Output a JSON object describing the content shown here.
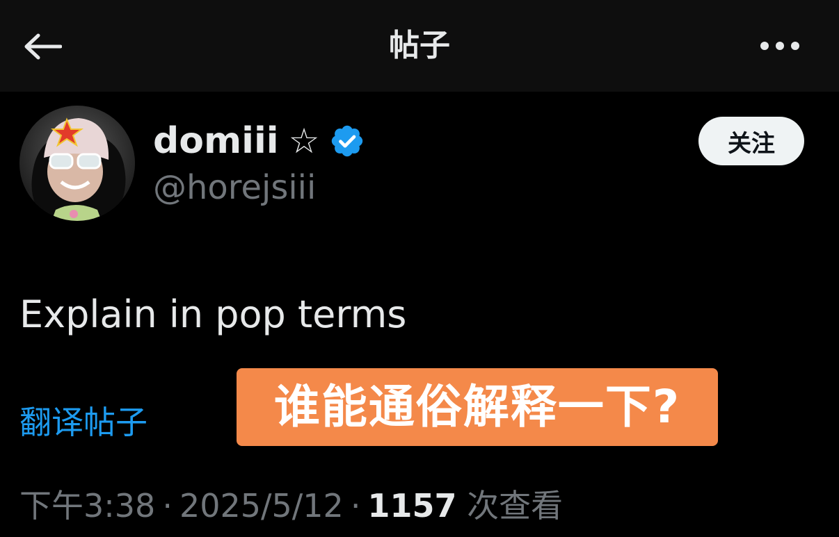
{
  "header": {
    "title": "帖子",
    "back_icon": "arrow-left-icon",
    "more_icon": "more-horizontal-icon"
  },
  "author": {
    "display_name": "domiii",
    "name_emoji": "☆",
    "handle": "@horejsiii",
    "verified": true,
    "verified_color": "#1d9bf0",
    "follow_label": "关注"
  },
  "post": {
    "text": "Explain in pop terms",
    "translate_label": "翻译帖子",
    "caption_overlay": "谁能通俗解释一下?"
  },
  "meta": {
    "time": "下午3:38",
    "date": "2025/5/12",
    "separator": "·",
    "views_count": "1157",
    "views_label": "次查看"
  },
  "colors": {
    "background": "#000000",
    "accent": "#1d9bf0",
    "caption_bg": "#f4894a"
  }
}
